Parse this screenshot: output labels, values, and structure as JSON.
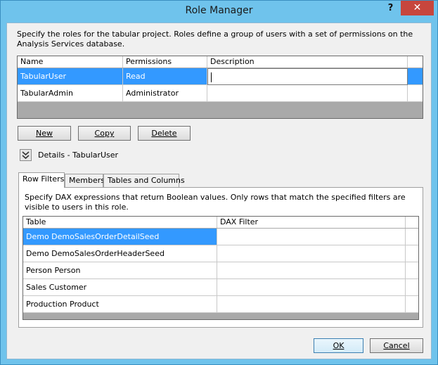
{
  "window": {
    "title": "Role Manager",
    "help_label": "?",
    "close_label": "✕"
  },
  "intro_text": "Specify the roles for the tabular project. Roles define a group of users with a set of permissions on the Analysis Services database.",
  "roles_grid": {
    "columns": [
      "Name",
      "Permissions",
      "Description"
    ],
    "rows": [
      {
        "name": "TabularUser",
        "permissions": "Read",
        "description": ""
      },
      {
        "name": "TabularAdmin",
        "permissions": "Administrator",
        "description": ""
      }
    ],
    "selected_row": 0
  },
  "role_buttons": {
    "new_label": "New",
    "copy_label": "Copy",
    "delete_label": "Delete"
  },
  "details": {
    "label": "Details - TabularUser",
    "toggle_icon": "double-chevron-down-icon"
  },
  "tabs": [
    {
      "label": "Row Filters",
      "active": true
    },
    {
      "label": "Members",
      "active": false
    },
    {
      "label": "Tables and Columns",
      "active": false
    }
  ],
  "row_filters": {
    "description": "Specify DAX expressions that return Boolean values. Only rows that match the specified filters are visible to users in this role.",
    "columns": [
      "Table",
      "DAX Filter"
    ],
    "rows": [
      {
        "table": "Demo DemoSalesOrderDetailSeed",
        "filter": ""
      },
      {
        "table": "Demo DemoSalesOrderHeaderSeed",
        "filter": ""
      },
      {
        "table": "Person Person",
        "filter": ""
      },
      {
        "table": "Sales Customer",
        "filter": ""
      },
      {
        "table": "Production Product",
        "filter": ""
      }
    ],
    "selected_row": 0
  },
  "dialog_buttons": {
    "ok_label": "OK",
    "cancel_label": "Cancel"
  },
  "colors": {
    "title_bar": "#6fc3ec",
    "close_button": "#c7463d",
    "selection": "#3399ff"
  }
}
